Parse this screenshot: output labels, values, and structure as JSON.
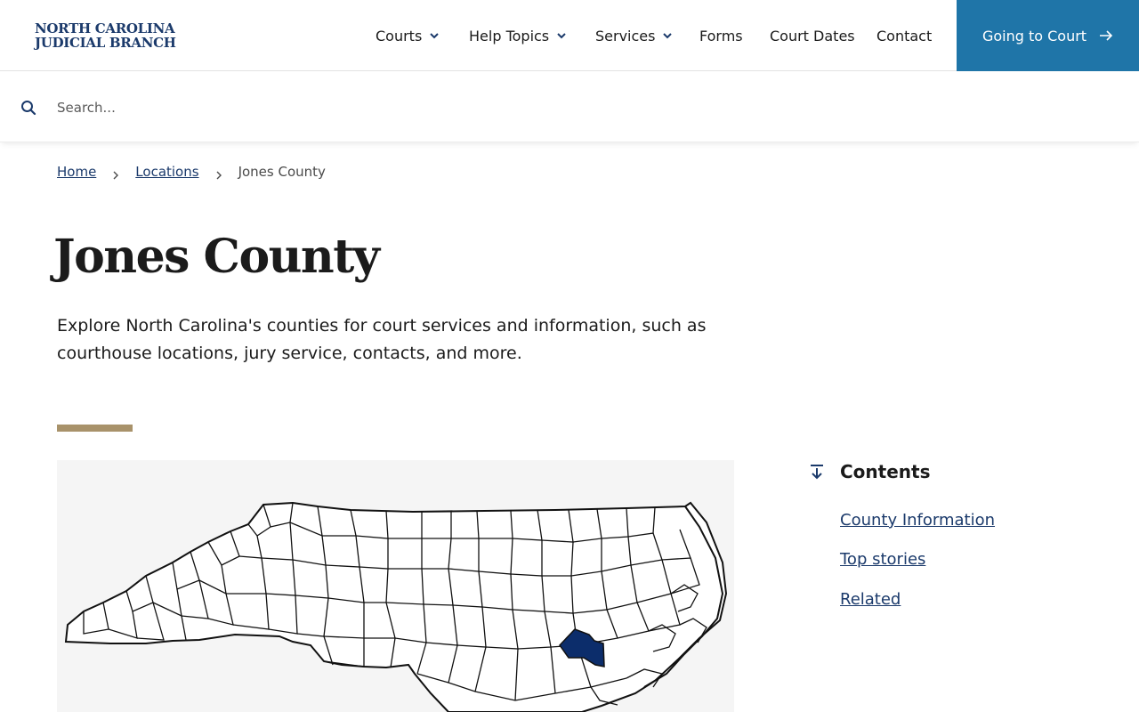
{
  "header": {
    "logo_line1": "NORTH CAROLINA",
    "logo_line2": "JUDICIAL BRANCH",
    "nav": [
      {
        "label": "Courts",
        "has_dropdown": true
      },
      {
        "label": "Help Topics",
        "has_dropdown": true
      },
      {
        "label": "Services",
        "has_dropdown": true
      },
      {
        "label": "Forms",
        "has_dropdown": false
      },
      {
        "label": "Court Dates",
        "has_dropdown": false
      },
      {
        "label": "Contact",
        "has_dropdown": false
      }
    ],
    "cta_label": "Going to Court"
  },
  "search": {
    "placeholder": "Search...",
    "value": ""
  },
  "breadcrumb": {
    "home": "Home",
    "locations": "Locations",
    "current": "Jones County"
  },
  "page": {
    "title": "Jones County",
    "intro": "Explore North Carolina's counties for court services and information, such as courthouse locations, jury service, contacts, and more."
  },
  "map": {
    "highlighted_county": "Jones County"
  },
  "contents": {
    "title": "Contents",
    "items": [
      {
        "label": "County Information"
      },
      {
        "label": "Top stories"
      },
      {
        "label": "Related"
      }
    ]
  },
  "colors": {
    "brand_navy": "#1b3a6b",
    "cta_blue": "#1f75a8",
    "accent_gold": "#a8926a",
    "highlight_county": "#0c2d6b",
    "map_background": "#f5f5f5"
  }
}
